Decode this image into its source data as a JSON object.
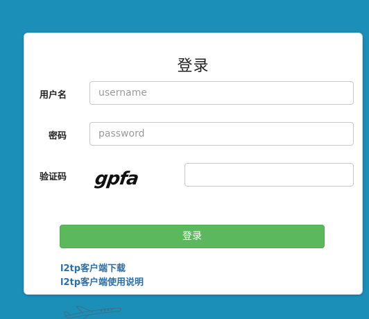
{
  "login_form": {
    "title": "登录",
    "username": {
      "label": "用户名",
      "placeholder": "username",
      "value": ""
    },
    "password": {
      "label": "密码",
      "placeholder": "password",
      "value": ""
    },
    "captcha": {
      "label": "验证码",
      "image_text": "gpfa",
      "value": ""
    },
    "submit_label": "登录"
  },
  "links": [
    {
      "label": "l2tp客户端下载"
    },
    {
      "label": "l2tp客户端使用说明"
    }
  ],
  "colors": {
    "background": "#1b8fb8",
    "button": "#5cb85c",
    "link": "#2a6fa8"
  },
  "icons": [
    "airplane-icon"
  ]
}
